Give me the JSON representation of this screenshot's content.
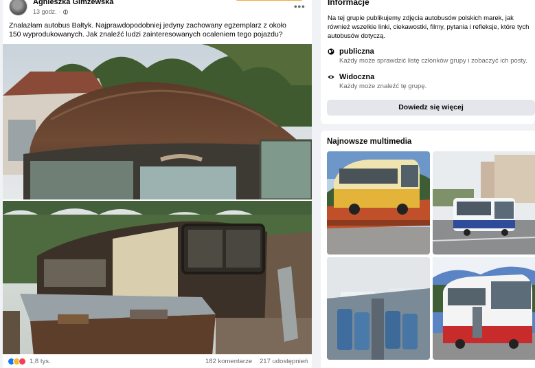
{
  "post": {
    "author": "Agnieszka Gimżewska",
    "time": "13 godz.",
    "menu_label": "•••",
    "text": "Znalazłam autobus Bałtyk. Najprawdopodobniej jedyny zachowany egzemplarz z około 150 wyprodukowanych. Jak znaleźć ludzi zainteresowanych ocaleniem tego pojazdu?",
    "reactions_count": "1,8 tys.",
    "comments": "182 komentarze",
    "shares": "217 udostępnień",
    "icons": [
      "globe-icon",
      "like-icon",
      "wow-icon",
      "love-icon"
    ]
  },
  "group_info": {
    "title": "Informacje",
    "description": "Na tej grupie publikujemy zdjęcia autobusów polskich marek, jak również wszelkie linki, ciekawostki, filmy, pytania i refleksje, które tych autobusów dotyczą.",
    "public_label": "publiczna",
    "public_desc": "Każdy może sprawdzić listę członków grupy i zobaczyć ich posty.",
    "visible_label": "Widoczna",
    "visible_desc": "Każdy może znaleźć tę grupę.",
    "more_button": "Dowiedz się więcej",
    "icons": [
      "globe-icon",
      "eye-icon"
    ]
  },
  "media": {
    "title": "Najnowsze multimedia"
  },
  "colors": {
    "accent": "#1877f2",
    "button_bg": "#e4e6eb",
    "page_bg": "#f0f2f5",
    "secondary_text": "#65676b"
  }
}
